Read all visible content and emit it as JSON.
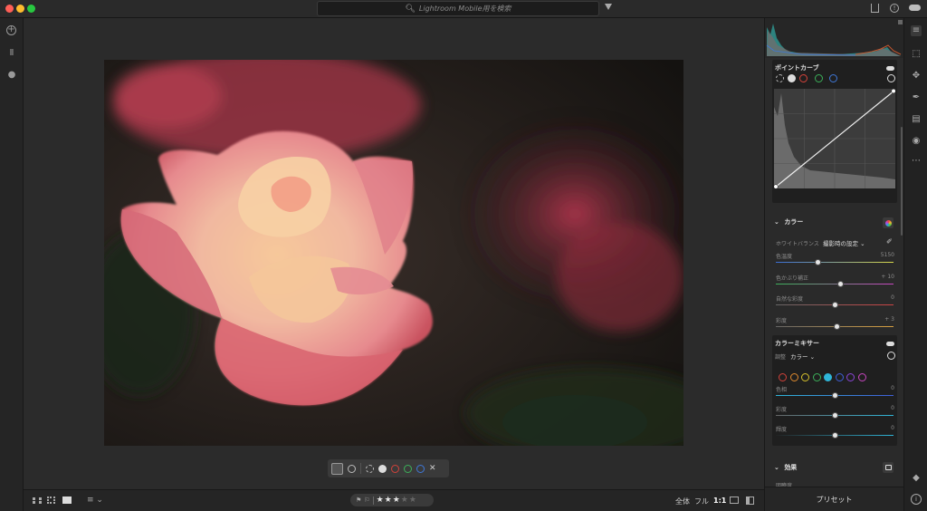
{
  "search": {
    "placeholder": "Lightroom Mobile用を検索"
  },
  "curve": {
    "title": "ポイントカーブ"
  },
  "color": {
    "title": "カラー",
    "wb_label": "ホワイトバランス",
    "wb_value": "撮影時の設定",
    "sliders": [
      {
        "label": "色温度",
        "value": "5150",
        "pos": 0.36
      },
      {
        "label": "色かぶり補正",
        "value": "+ 10",
        "pos": 0.55
      },
      {
        "label": "自然な彩度",
        "value": "0",
        "pos": 0.5
      },
      {
        "label": "彩度",
        "value": "+ 3",
        "pos": 0.52
      }
    ]
  },
  "mixer": {
    "title": "カラーミキサー",
    "adjust_label": "調整",
    "adjust_value": "カラー",
    "sliders": [
      {
        "label": "色相",
        "value": "0",
        "pos": 0.5
      },
      {
        "label": "彩度",
        "value": "0",
        "pos": 0.5
      },
      {
        "label": "輝度",
        "value": "0",
        "pos": 0.5
      }
    ]
  },
  "effects": {
    "title": "効果",
    "first_label": "明瞭度"
  },
  "presets": {
    "label": "プリセット"
  },
  "bottom": {
    "zoom_all": "全体",
    "zoom_full": "フル",
    "zoom_1to1": "1:1"
  },
  "rating": {
    "stars_filled": 3,
    "stars_total": 5,
    "star_char": "★"
  },
  "colors": {
    "accent": "#2fb5d8",
    "panel": "#2a2a2a",
    "bg": "#1e1e1e"
  },
  "icons": [
    "search-icon",
    "filter-icon",
    "share-icon",
    "help-icon",
    "cloud-icon",
    "add-photo-icon",
    "library-icon",
    "people-icon",
    "edit-sliders-icon",
    "crop-icon",
    "heal-icon",
    "brush-icon",
    "gradient-icon",
    "radial-icon",
    "more-icon",
    "tag-icon",
    "info-icon"
  ]
}
